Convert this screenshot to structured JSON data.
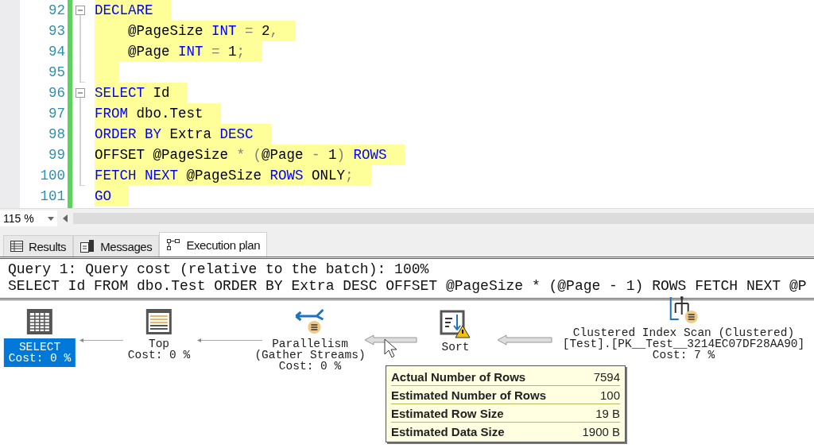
{
  "editor": {
    "lines": [
      {
        "number": "92",
        "kind": "start",
        "tokens": [
          {
            "kind": "keyword",
            "text": "DECLARE"
          }
        ]
      },
      {
        "number": "93",
        "kind": "line",
        "tokens": [
          {
            "kind": "plain",
            "text": "    @PageSize "
          },
          {
            "kind": "keyword",
            "text": "INT"
          },
          {
            "kind": "operator",
            "text": " = "
          },
          {
            "kind": "plain",
            "text": "2"
          },
          {
            "kind": "operator",
            "text": ","
          }
        ]
      },
      {
        "number": "94",
        "kind": "line",
        "tokens": [
          {
            "kind": "plain",
            "text": "    @Page "
          },
          {
            "kind": "keyword",
            "text": "INT"
          },
          {
            "kind": "operator",
            "text": " = "
          },
          {
            "kind": "plain",
            "text": "1"
          },
          {
            "kind": "operator",
            "text": ";"
          }
        ]
      },
      {
        "number": "95",
        "kind": "end"
      },
      {
        "number": "96",
        "kind": "start",
        "tokens": [
          {
            "kind": "keyword",
            "text": "SELECT"
          },
          {
            "kind": "plain",
            "text": " Id"
          }
        ]
      },
      {
        "number": "97",
        "kind": "line",
        "tokens": [
          {
            "kind": "keyword",
            "text": "FROM"
          },
          {
            "kind": "plain",
            "text": " dbo.Test"
          }
        ]
      },
      {
        "number": "98",
        "kind": "line",
        "tokens": [
          {
            "kind": "keyword",
            "text": "ORDER BY"
          },
          {
            "kind": "plain",
            "text": " Extra "
          },
          {
            "kind": "keyword",
            "text": "DESC"
          }
        ]
      },
      {
        "number": "99",
        "kind": "line",
        "tokens": [
          {
            "kind": "plain",
            "text": "OFFSET @PageSize "
          },
          {
            "kind": "operator",
            "text": "* ("
          },
          {
            "kind": "plain",
            "text": "@Page "
          },
          {
            "kind": "operator",
            "text": "-"
          },
          {
            "kind": "plain",
            "text": " 1"
          },
          {
            "kind": "operator",
            "text": ")"
          },
          {
            "kind": "keyword",
            "text": " ROWS"
          }
        ]
      },
      {
        "number": "100",
        "kind": "end",
        "tokens": [
          {
            "kind": "keyword",
            "text": "FETCH NEXT"
          },
          {
            "kind": "plain",
            "text": " @PageSize "
          },
          {
            "kind": "keyword",
            "text": "ROWS"
          },
          {
            "kind": "plain",
            "text": " ONLY"
          },
          {
            "kind": "operator",
            "text": ";"
          }
        ]
      },
      {
        "number": "101",
        "kind": "none",
        "tokens": [
          {
            "kind": "keyword",
            "text": "GO"
          }
        ]
      }
    ]
  },
  "zoom": {
    "value": "115 %"
  },
  "tabs": [
    {
      "label": "Results",
      "kind": "grid",
      "selected": false
    },
    {
      "label": "Messages",
      "kind": "messages",
      "selected": false
    },
    {
      "label": "Execution plan",
      "kind": "plan",
      "selected": true
    }
  ],
  "query": {
    "header": "Query 1: Query cost (relative to the batch): 100%",
    "text": "SELECT Id FROM dbo.Test ORDER BY Extra DESC OFFSET @PageSize * (@Page - 1) ROWS FETCH NEXT @P"
  },
  "plan": {
    "nodes": [
      {
        "kind": "select",
        "lines": [
          "SELECT",
          "Cost: 0 %"
        ],
        "selected": true
      },
      {
        "kind": "top",
        "lines": [
          "Top",
          "Cost: 0 %"
        ],
        "selected": false
      },
      {
        "kind": "parallelism",
        "lines": [
          "Parallelism",
          "(Gather Streams)",
          "Cost: 0 %"
        ],
        "selected": false
      },
      {
        "kind": "sort",
        "lines": [
          "Sort"
        ],
        "selected": false
      },
      {
        "kind": "scan",
        "lines": [
          "Clustered Index Scan (Clustered)",
          "[Test].[PK__Test__3214EC07DF28AA90]",
          "Cost: 7 %"
        ],
        "selected": false
      }
    ],
    "arrows": [
      {
        "kind": "thin"
      },
      {
        "kind": "thin"
      },
      {
        "kind": "thick"
      },
      {
        "kind": "thick"
      }
    ],
    "tooltip": [
      {
        "label": "Actual Number of Rows",
        "value": "7594"
      },
      {
        "label": "Estimated Number of Rows",
        "value": "100"
      },
      {
        "label": "Estimated Row Size",
        "value": "19 B"
      },
      {
        "label": "Estimated Data Size",
        "value": "1900 B"
      }
    ]
  }
}
